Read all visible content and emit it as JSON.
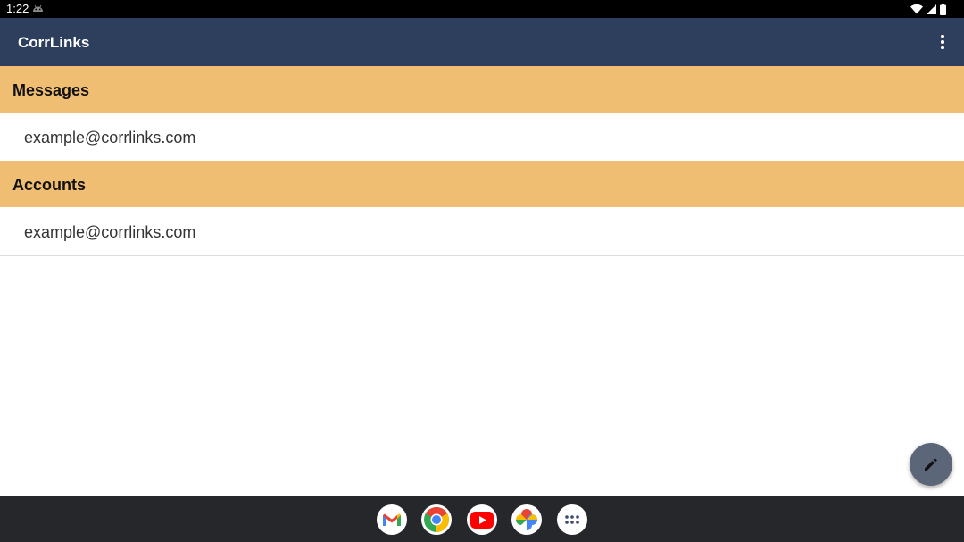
{
  "status_bar": {
    "time": "1:22",
    "notification_icon": "android-robot-icon",
    "wifi_icon": "wifi-icon",
    "signal_icon": "cell-signal-icon",
    "battery_icon": "battery-icon"
  },
  "app_bar": {
    "title": "CorrLinks",
    "menu_icon": "overflow-menu-icon",
    "color": "#2e3f5e"
  },
  "sections": {
    "messages": {
      "header": "Messages",
      "item": "example@corrlinks.com"
    },
    "accounts": {
      "header": "Accounts",
      "item": "example@corrlinks.com"
    },
    "header_color": "#f0be72"
  },
  "fab": {
    "icon": "pencil-icon",
    "color": "#5b6678"
  },
  "taskbar": {
    "apps": [
      {
        "name": "Gmail",
        "icon": "gmail-icon"
      },
      {
        "name": "Chrome",
        "icon": "chrome-icon"
      },
      {
        "name": "YouTube",
        "icon": "youtube-icon"
      },
      {
        "name": "Photos",
        "icon": "photos-icon"
      },
      {
        "name": "App drawer",
        "icon": "app-drawer-icon"
      }
    ]
  }
}
